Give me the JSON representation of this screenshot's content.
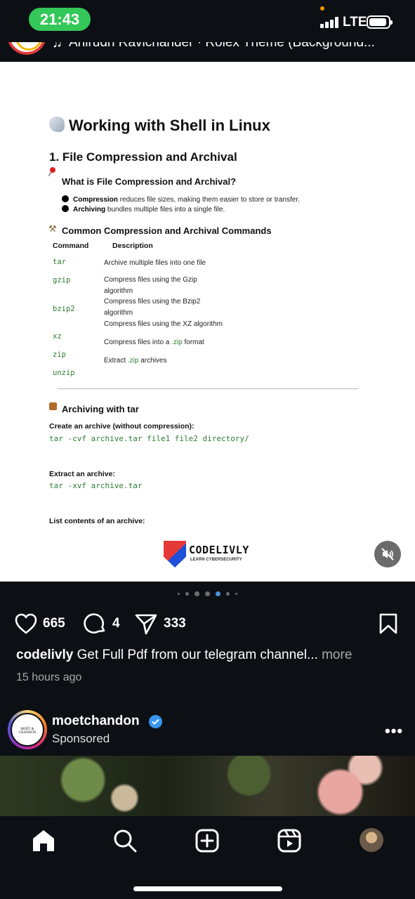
{
  "status_bar": {
    "time": "21:43",
    "network": "LTE"
  },
  "reel_header": {
    "audio_text": "Anirudh Ravichander · Rolex Theme (Background..."
  },
  "document": {
    "title": "Working with Shell in Linux",
    "section_heading": "1. File Compression and Archival",
    "what_is_heading": "What is File Compression and Archival?",
    "bullets": [
      {
        "bold": "Compression",
        "text": " reduces file sizes, making them easier to store or transfer."
      },
      {
        "bold": "Archiving",
        "text": " bundles multiple files into a single file."
      }
    ],
    "commands_heading": "Common Compression and Archival Commands",
    "table_headers": [
      "Command",
      "Description"
    ],
    "commands": [
      "tar",
      "gzip",
      "bzip2",
      "xz",
      "zip",
      "unzip"
    ],
    "descriptions": [
      "Archive multiple files into one file",
      "Compress files using the Gzip algorithm",
      "Compress files using the Bzip2 algorithm",
      "Compress files using the XZ algorithm",
      "Compress files into a",
      ".zip",
      "format",
      "Extract",
      ".zip",
      "archives"
    ],
    "tar_heading": "Archiving with tar",
    "create_label": "Create an archive (without compression):",
    "create_code": "tar -cvf archive.tar file1 file2 directory/",
    "extract_label": "Extract an archive:",
    "extract_code": "tar -xvf archive.tar",
    "list_label": "List contents of an archive:",
    "logo_text": "CODELIVLY",
    "logo_sub": "LEARN CYBERSECURITY"
  },
  "carousel": {
    "total": 7,
    "active_index": 4
  },
  "actions": {
    "likes": "665",
    "comments": "4",
    "shares": "333"
  },
  "caption": {
    "username": "codelivly",
    "text": " Get Full Pdf from our telegram channel...",
    "more": " more",
    "timestamp": "15 hours ago"
  },
  "sponsored": {
    "name": "moetchandon",
    "label": "Sponsored",
    "avatar_text": "MOËT & CHANDON"
  },
  "colors": {
    "background": "#0c1014",
    "time_pill": "#34c759",
    "code_green": "#2e7d32",
    "verified_blue": "#3897f0",
    "active_dot": "#4a90e2"
  },
  "icons": [
    "heart-icon",
    "comment-icon",
    "share-icon",
    "bookmark-icon",
    "home-icon",
    "search-icon",
    "create-icon",
    "reels-icon",
    "profile-icon",
    "mute-icon"
  ]
}
